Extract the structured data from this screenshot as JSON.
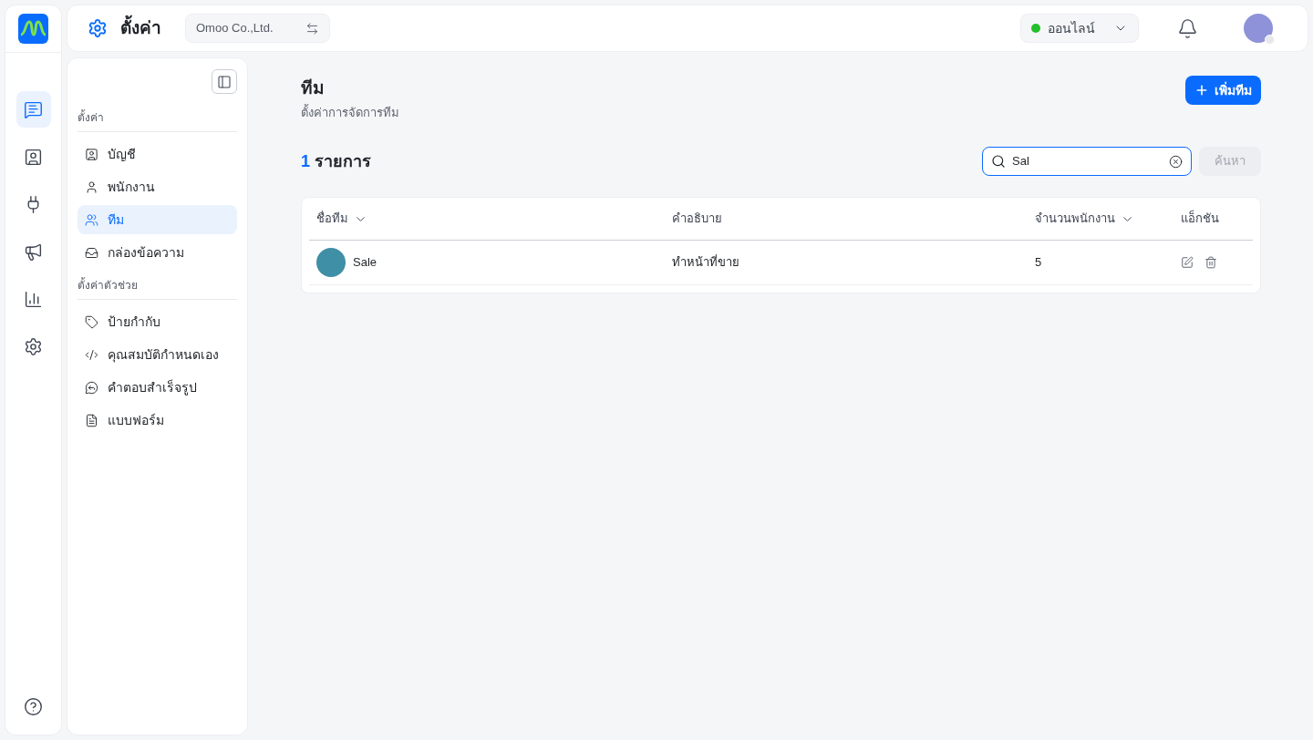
{
  "rail": {
    "items": [
      {
        "kind": "chat",
        "selected": true
      },
      {
        "kind": "contacts",
        "selected": false
      },
      {
        "kind": "integrations",
        "selected": false
      },
      {
        "kind": "broadcast",
        "selected": false
      },
      {
        "kind": "reports",
        "selected": false
      },
      {
        "kind": "settings",
        "selected": false
      }
    ]
  },
  "header": {
    "title": "ตั้งค่า",
    "company": "Omoo Co.,Ltd.",
    "status": {
      "label": "ออนไลน์",
      "online": true
    }
  },
  "sidebar": {
    "sections": [
      {
        "title": "ตั้งค่า",
        "items": [
          {
            "kind": "account",
            "label": "บัญชี",
            "selected": false
          },
          {
            "kind": "user",
            "label": "พนักงาน",
            "selected": false
          },
          {
            "kind": "team",
            "label": "ทีม",
            "selected": true
          },
          {
            "kind": "inbox",
            "label": "กล่องข้อความ",
            "selected": false
          }
        ]
      },
      {
        "title": "ตั้งค่าตัวช่วย",
        "items": [
          {
            "kind": "tag",
            "label": "ป้ายกำกับ",
            "selected": false
          },
          {
            "kind": "code",
            "label": "คุณสมบัติกำหนดเอง",
            "selected": false
          },
          {
            "kind": "reply",
            "label": "คำตอบสำเร็จรูป",
            "selected": false
          },
          {
            "kind": "form",
            "label": "แบบฟอร์ม",
            "selected": false
          }
        ]
      }
    ]
  },
  "page": {
    "title": "ทีม",
    "subtitle": "ตั้งค่าการจัดการทีม",
    "add_button": "เพิ่มทีม",
    "count": "1",
    "count_label": "รายการ",
    "search": {
      "value": "Sal",
      "button": "ค้นหา",
      "button_disabled": true
    }
  },
  "table": {
    "columns": [
      {
        "label": "ชื่อทีม",
        "sortable": true
      },
      {
        "label": "คำอธิบาย",
        "sortable": false
      },
      {
        "label": "จำนวนพนักงาน",
        "sortable": true
      },
      {
        "label": "แอ็กชัน",
        "sortable": false
      }
    ],
    "rows": [
      {
        "name": "Sale",
        "description": "ทำหน้าที่ขาย",
        "members": "5"
      }
    ]
  }
}
